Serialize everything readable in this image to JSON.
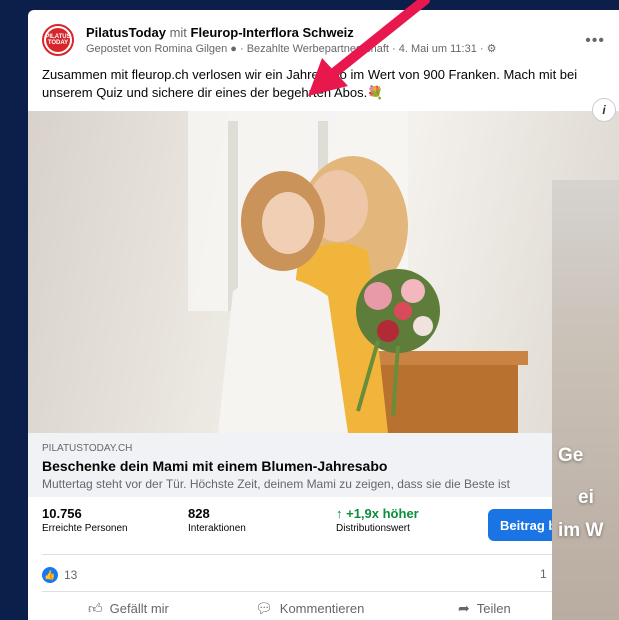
{
  "post": {
    "page_name": "PilatusToday",
    "with_word": "mit",
    "partner_name": "Fleurop-Interflora Schweiz",
    "meta": "Gepostet von Romina Gilgen ● · Bezahlte Werbepartnerschaft · 4. Mai um 11:31 · ⚙",
    "text": "Zusammen mit fleurop.ch verlosen wir ein Jahresabo im Wert von 900 Franken. Mach mit bei unserem Quiz und sichere dir eines der begehrten Abos.💐",
    "avatar_text_1": "PILATUS",
    "avatar_text_2": "TODAY"
  },
  "link": {
    "domain": "PILATUSTODAY.CH",
    "title": "Beschenke dein Mami mit einem Blumen-Jahresabo",
    "description": "Muttertag steht vor der Tür. Höchste Zeit, deinem Mami zu zeigen, dass sie die Beste ist"
  },
  "stats": {
    "reach_value": "10.756",
    "reach_label": "Erreichte Personen",
    "interactions_value": "828",
    "interactions_label": "Interaktionen",
    "distribution_value": "↑ +1,9x höher",
    "distribution_label": "Distributionswert",
    "boost_label": "Beitrag b"
  },
  "reactions": {
    "count": "13",
    "comments": "1"
  },
  "actions": {
    "like": "Gefällt mir",
    "comment": "Kommentieren",
    "share": "Teilen"
  },
  "video_overlay": {
    "line1": "Ge",
    "line2": "ei",
    "line3": "im W"
  },
  "colors": {
    "background": "#0b1f4a",
    "arrow": "#e8184f",
    "accent": "#1b74e4"
  }
}
